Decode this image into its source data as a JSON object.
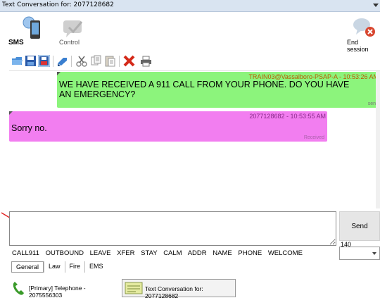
{
  "window": {
    "title": "Text Conversation for: 2077128682"
  },
  "toolbar": {
    "sms_label": "SMS",
    "control_label": "Control",
    "end_session_label": "End session"
  },
  "conversation": {
    "messages": [
      {
        "direction": "outgoing",
        "meta": "TRAIN03@Vassalboro-PSAP-A - 10:53:26 AM",
        "text": "WE HAVE RECEIVED A 911 CALL FROM YOUR PHONE. DO YOU HAVE AN EMERGENCY?",
        "status": "sent",
        "color": "#8cf47c"
      },
      {
        "direction": "incoming",
        "meta": "2077128682 - 10:53:55 AM",
        "text": "Sorry no.",
        "status": "Received",
        "color": "#f27ef0"
      }
    ]
  },
  "compose": {
    "input_value": "",
    "send_label": "Send",
    "char_count": "140"
  },
  "quick_messages": [
    "CALL911",
    "OUTBOUND",
    "LEAVE",
    "XFER",
    "STAY",
    "CALM",
    "ADDR",
    "NAME",
    "PHONE",
    "WELCOME"
  ],
  "tabs": [
    "General",
    "Law",
    "Fire",
    "EMS"
  ],
  "taskbar": {
    "phone_label": "[Primary] Telephone - 2075556303",
    "text_label": "Text Conversation for: 2077128682"
  },
  "colors": {
    "annotation_arrow": "#e02020"
  }
}
